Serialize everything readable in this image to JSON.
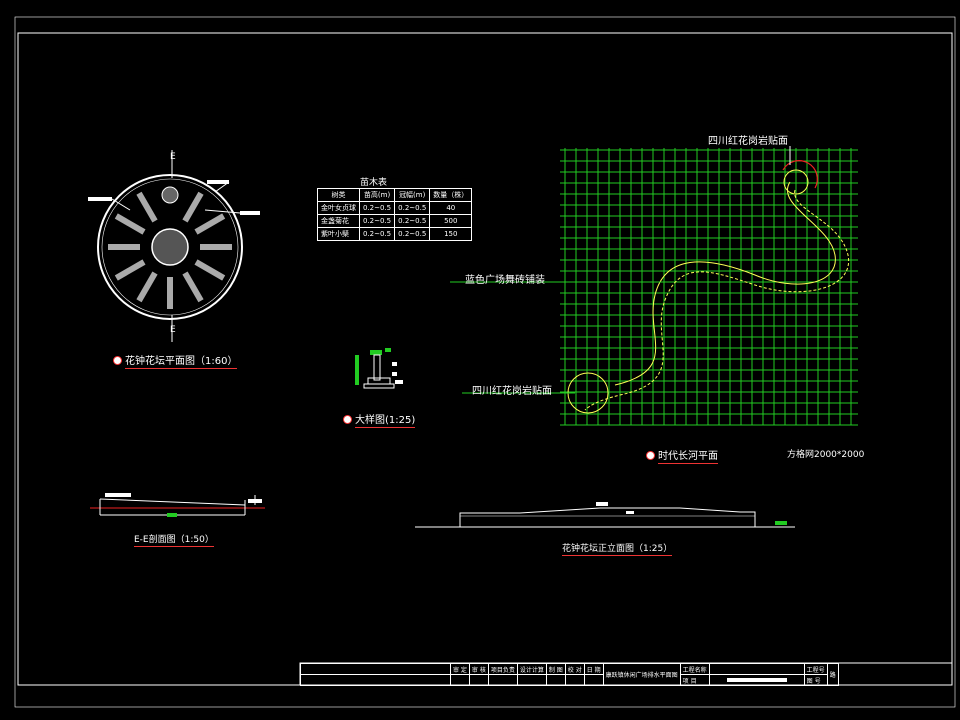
{
  "drawing": {
    "clock_plan_label": "E",
    "clock_plan_label_bottom": "E",
    "plant_table": {
      "title": "苗木表",
      "headers": [
        "树类",
        "苗高(m)",
        "冠幅(m)",
        "数量（株）"
      ],
      "rows": [
        [
          "金叶女贞球",
          "0.2~0.5",
          "0.2~0.5",
          "40"
        ],
        [
          "金盏菊花",
          "0.2~0.5",
          "0.2~0.5",
          "500"
        ],
        [
          "紫叶小檗",
          "0.2~0.5",
          "0.2~0.5",
          "150"
        ]
      ]
    },
    "river_labels": {
      "top": "四川红花岗岩贴面",
      "middle": "蓝色广场舞砖铺装",
      "bottom": "四川红花岗岩贴面",
      "grid_note": "方格网2000*2000"
    },
    "captions": {
      "clock_plan": "花钟花坛平面图（1:60）",
      "detail": "大样图(1:25)",
      "river_plan": "时代长河平面",
      "section": "E-E剖面图（1:50）",
      "elevation": "花钟花坛正立面图（1:25）"
    },
    "title_block": {
      "cells": [
        "审  定",
        "审  核",
        "项目负责",
        "设计计算",
        "制  图",
        "校  对",
        "日  期"
      ],
      "drawing_name": "康跃镇休闲广场排水平面图",
      "project_label": "工程名称",
      "sub_label": "项  目",
      "no_label": "工程号",
      "sheet_label": "图  号",
      "sheet_value": "路"
    }
  }
}
